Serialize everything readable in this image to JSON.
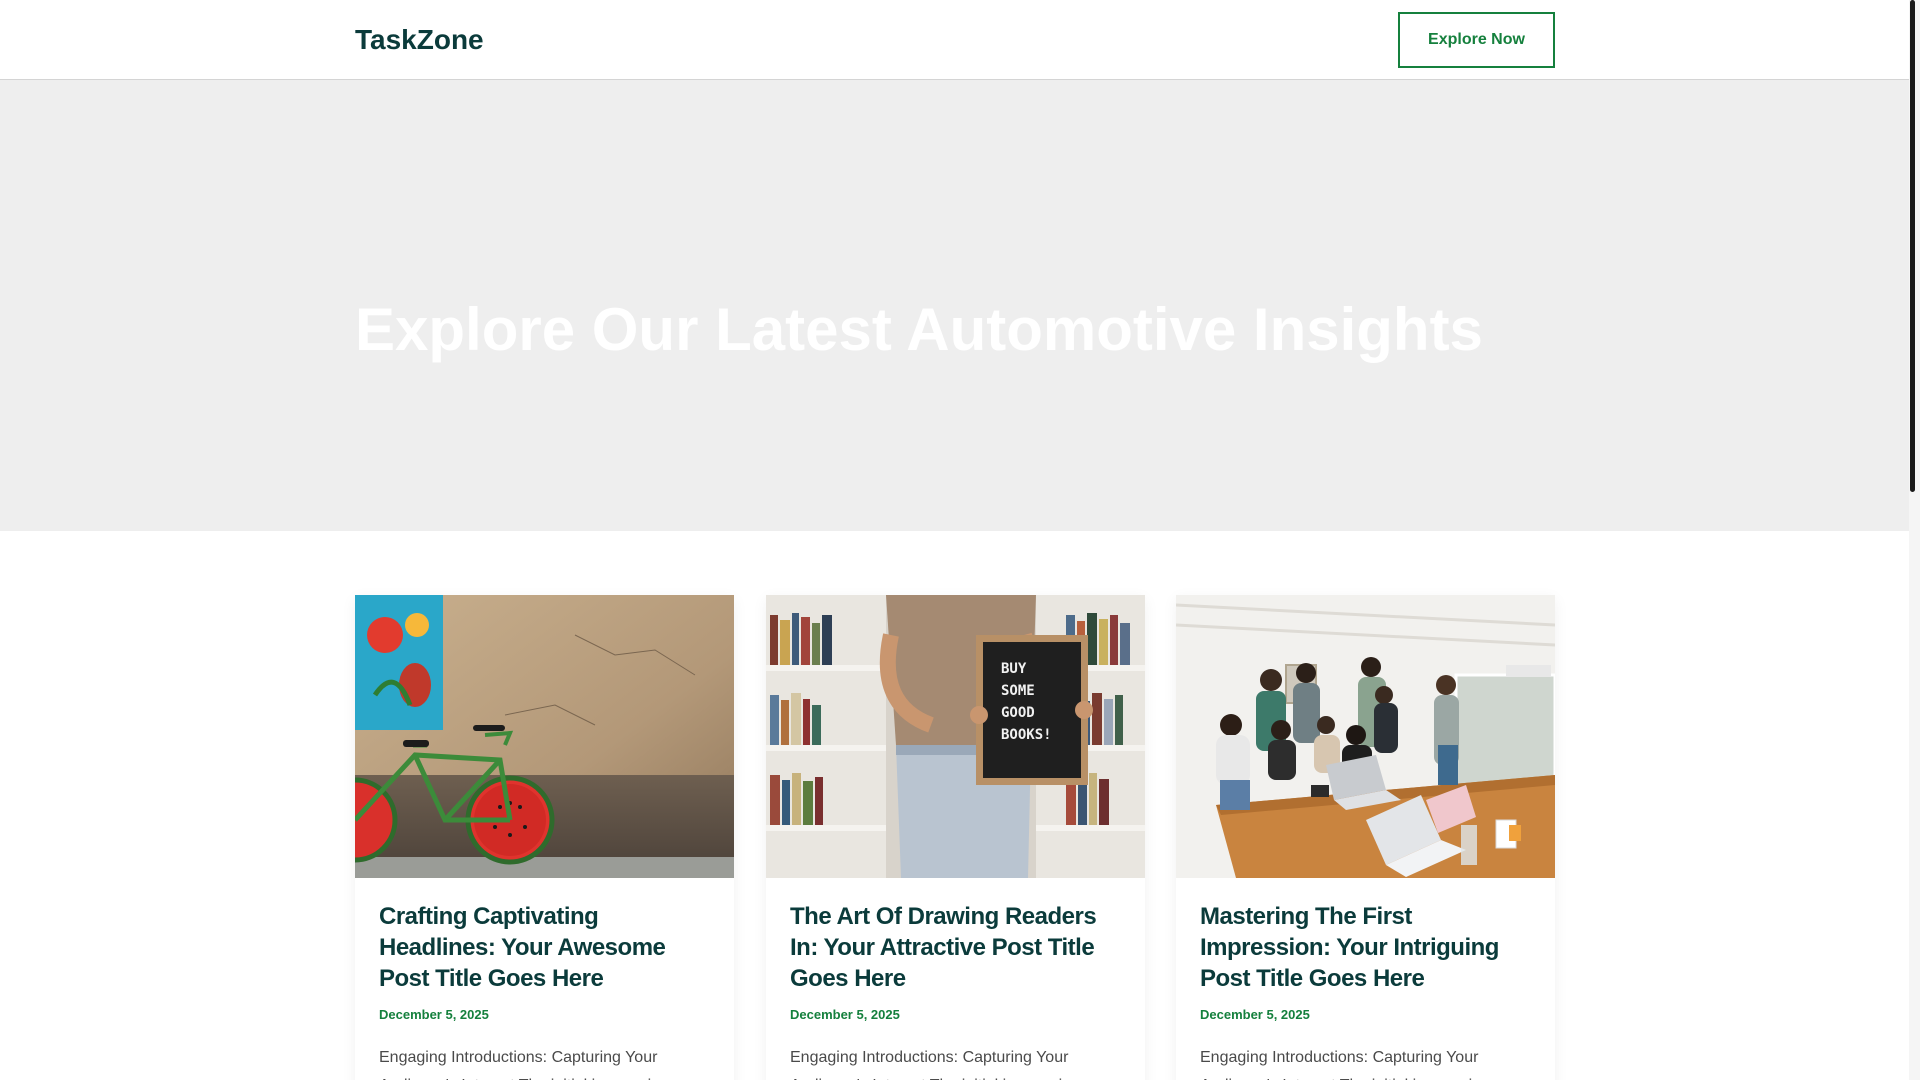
{
  "header": {
    "brand": "TaskZone",
    "cta_label": "Explore Now"
  },
  "hero": {
    "title": "Explore Our Latest Automotive Insights"
  },
  "posts": [
    {
      "title": "Crafting Captivating Headlines: Your Awesome Post Title Goes Here",
      "date": "December 5, 2025",
      "excerpt": "Engaging Introductions: Capturing Your Audience's Interest The initial impression",
      "image": "bicycle-watermelon-wheels-photo"
    },
    {
      "title": "The Art Of Drawing Readers In: Your Attractive Post Title Goes Here",
      "date": "December 5, 2025",
      "excerpt": "Engaging Introductions: Capturing Your Audience's Interest The initial impression",
      "image": "person-holding-sign-photo",
      "image_text": [
        "BUY",
        "SOME",
        "GOOD",
        "BOOKS!"
      ]
    },
    {
      "title": "Mastering The First Impression: Your Intriguing Post Title Goes Here",
      "date": "December 5, 2025",
      "excerpt": "Engaging Introductions: Capturing Your Audience's Interest The initial impression",
      "image": "team-meeting-laptops-photo"
    }
  ],
  "colors": {
    "brand_text": "#0b3b3b",
    "accent": "#15803d",
    "hero_bg": "#eeeeee"
  }
}
